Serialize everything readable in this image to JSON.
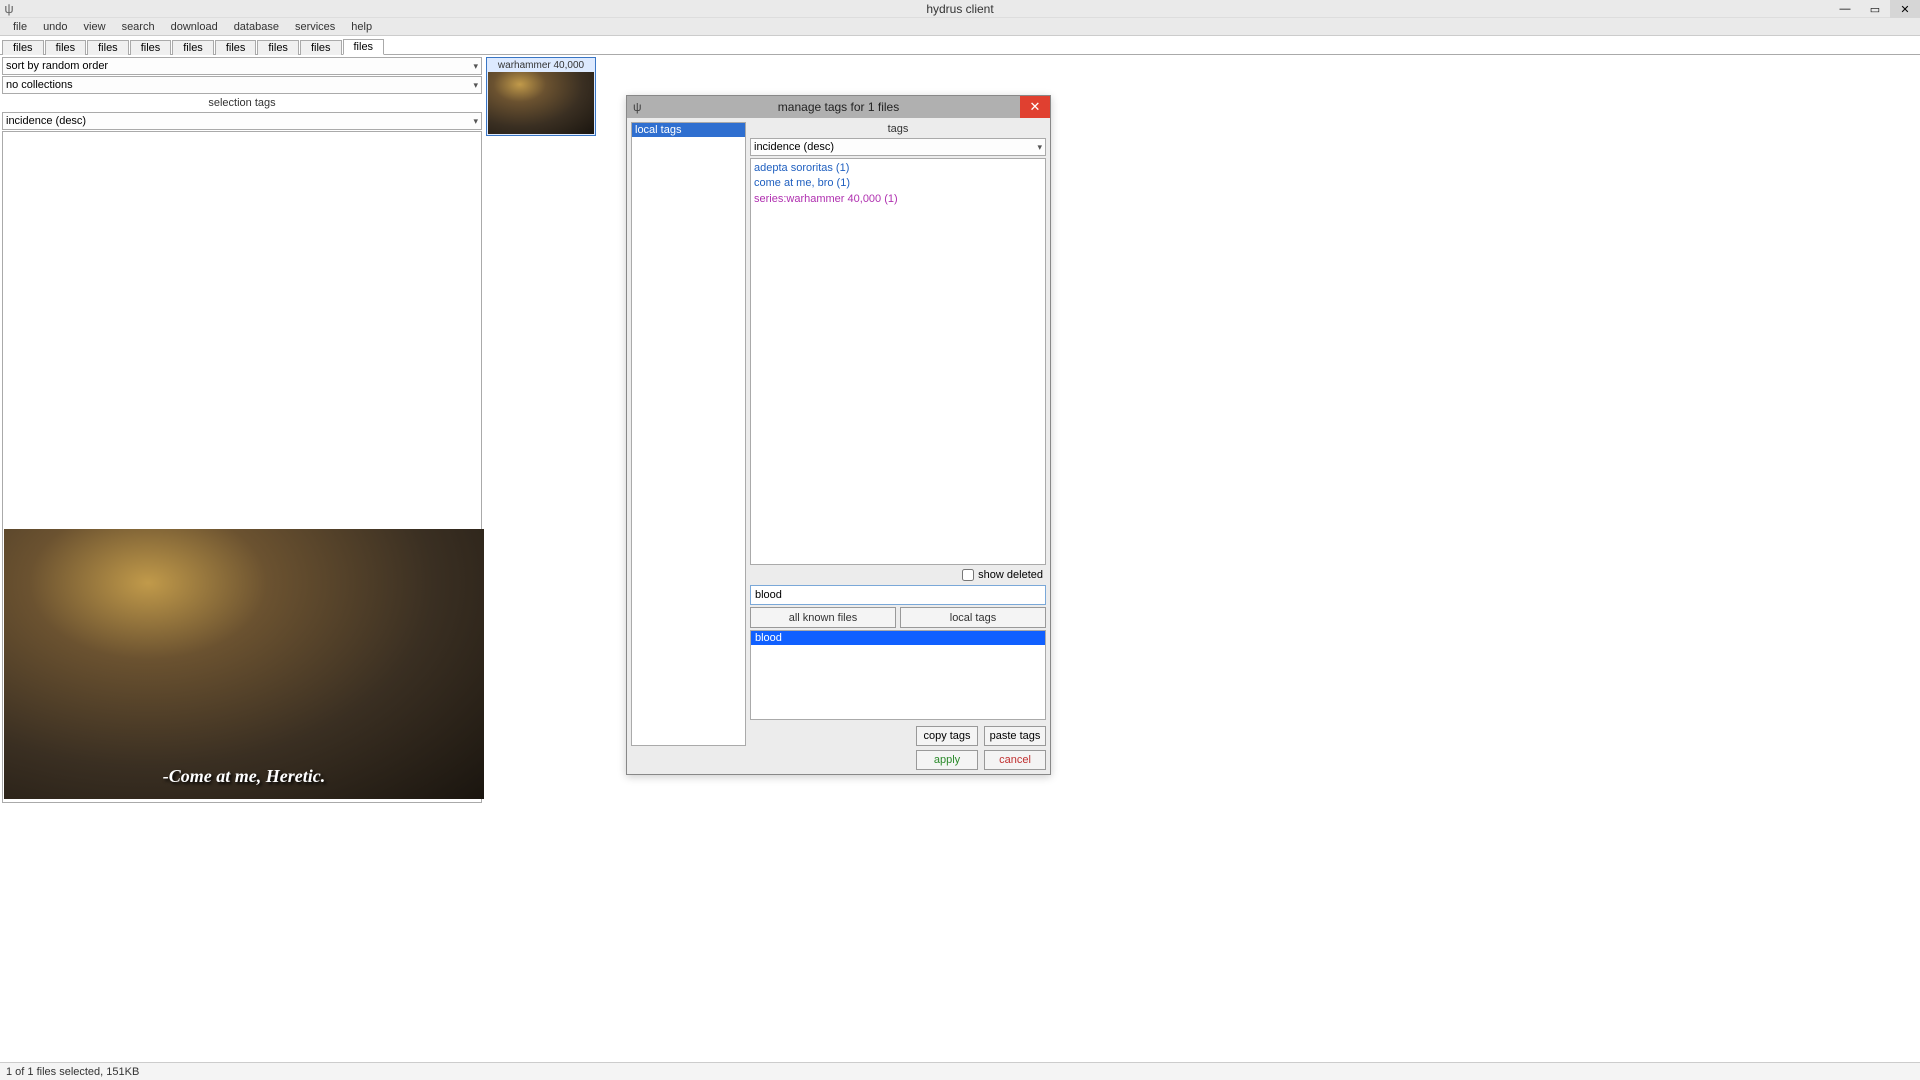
{
  "app_title": "hydrus client",
  "menubar": [
    "file",
    "undo",
    "view",
    "search",
    "download",
    "database",
    "services",
    "help"
  ],
  "tabs": [
    "files",
    "files",
    "files",
    "files",
    "files",
    "files",
    "files",
    "files",
    "files"
  ],
  "active_tab_index": 8,
  "left": {
    "sort_dropdown": "sort by random order",
    "collections_dropdown": "no collections",
    "section_label": "selection tags",
    "incidence_dropdown": "incidence (desc)",
    "preview_caption": "-Come at me, Heretic."
  },
  "thumbnail": {
    "label": "warhammer 40,000"
  },
  "dialog": {
    "title": "manage tags for 1 files",
    "left_selected": "local tags",
    "tags_label": "tags",
    "incidence_dropdown": "incidence (desc)",
    "tags": [
      {
        "text": "adepta sororitas (1)",
        "class": "tag-blue"
      },
      {
        "text": "come at me, bro (1)",
        "class": "tag-blue"
      },
      {
        "text": "series:warhammer 40,000 (1)",
        "class": "tag-purple"
      }
    ],
    "show_deleted_label": "show deleted",
    "show_deleted_checked": false,
    "input_value": "blood",
    "btn_all_known": "all known files",
    "btn_local_tags": "local tags",
    "suggest_selected": "blood",
    "btn_copy": "copy tags",
    "btn_paste": "paste tags",
    "btn_apply": "apply",
    "btn_cancel": "cancel"
  },
  "status": "1 of 1 files selected, 151KB"
}
